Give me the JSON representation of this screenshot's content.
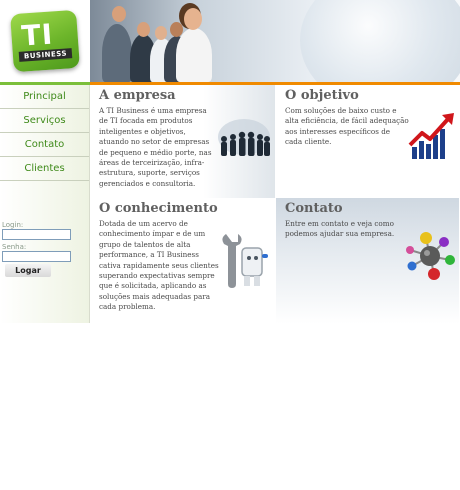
{
  "logo": {
    "main_text": "TI",
    "sub_text": "BUSINESS"
  },
  "nav": {
    "items": [
      {
        "label": "Principal"
      },
      {
        "label": "Serviços"
      },
      {
        "label": "Contato"
      },
      {
        "label": "Clientes"
      }
    ]
  },
  "login": {
    "login_label": "Login:",
    "login_value": "",
    "password_label": "Senha:",
    "password_value": "",
    "button_label": "Logar"
  },
  "sections": {
    "empresa": {
      "title": "A empresa",
      "text": "A TI Business é uma empresa de TI focada em produtos inteligentes e objetivos, atuando no setor de empresas de pequeno e médio porte, nas áreas de terceirização, infra-estrutura, suporte, serviços gerenciados e consultoria."
    },
    "objetivo": {
      "title": "O objetivo",
      "text": "Com soluções de baixo custo e alta eficiência, de fácil adequação aos interesses específicos de cada cliente."
    },
    "conhecimento": {
      "title": "O conhecimento",
      "text": "Dotada de um acervo de conhecimento ímpar e de um grupo de talentos de alta performance, a TI Business cativa rapidamente seus clientes superando expectativas sempre que é solicitada, aplicando as soluções mais adequadas para cada problema."
    },
    "contato": {
      "title": "Contato",
      "text": "Entre em contato e veja como podemos ajudar sua empresa."
    }
  },
  "colors": {
    "accent_orange": "#f08a00",
    "nav_green": "#3f8a1a",
    "logo_green": "#6cb52a"
  }
}
